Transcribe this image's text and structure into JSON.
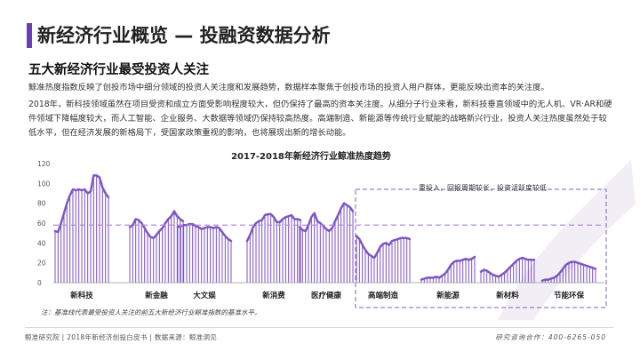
{
  "header": {
    "title": "新经济行业概览 — 投融资数据分析",
    "section_heading": "五大新经济行业最受投资人关注",
    "paragraph_1": "鲸准热度指数反映了创投市场中细分领域的投资人关注度和发展趋势，数据样本聚焦于创投市场的投资人用户群体，更能反映出资本的关注度。",
    "paragraph_2": "2018年，新科技领域虽然在项目受资和成立方面受影响程度较大，但仍保持了最高的资本关注度。从细分子行业来看，新科技垂直领域中的无人机、VR·AR和硬件领域下降幅度较大，而人工智能、企业服务、大数据等领域仍保持较高热度。高端制造、新能源等传统行业赋能的战略新兴行业，投资人关注热度虽然处于较低水平，但在经济发展的新格局下，受国家政策重视的影响，也将展现出新的增长动能。"
  },
  "footer": {
    "left": "鲸准研究院 | 2018年新经济创投白皮书 | 数据来源：鲸准洞见",
    "right": "研究咨询合作：400-6265-050"
  },
  "colors": {
    "accent": "#6a3fb5",
    "bars": "#7b4fc9",
    "line": "#7e57c2",
    "baseline": "#b58ad8",
    "box": "#7b62b8"
  },
  "chart_data": {
    "type": "bar",
    "title": "2017-2018年新经济行业鲸准热度趋势",
    "ylim": [
      0,
      120
    ],
    "y_ticks": [
      0,
      20,
      40,
      60,
      80,
      100,
      120
    ],
    "baseline": 58,
    "annotation": "重投入，回报周期较长，投资活跃度较低",
    "note": "注：基准线代表最受投资人关注的前五大新经济行业鲸准指数的基准水平。",
    "grid": false,
    "series": [
      {
        "name": "新科技",
        "values": [
          52,
          51,
          60,
          70,
          80,
          88,
          94,
          93,
          94,
          93,
          94,
          90,
          92,
          108,
          108,
          106,
          96,
          90,
          86
        ]
      },
      {
        "name": "新金融",
        "values": [
          56,
          58,
          64,
          63,
          60,
          55,
          50,
          46,
          45,
          48,
          52,
          55,
          60,
          64,
          67,
          72,
          67,
          64,
          62
        ]
      },
      {
        "name": "大文娱",
        "values": [
          56,
          57,
          58,
          58,
          59,
          59,
          57,
          56,
          54,
          55,
          56,
          56,
          55,
          56,
          55,
          51,
          47,
          44,
          42
        ]
      },
      {
        "name": "新消费",
        "values": [
          42,
          48,
          56,
          60,
          62,
          63,
          68,
          69,
          69,
          66,
          61,
          61,
          64,
          66,
          67,
          68,
          64,
          64,
          63
        ]
      },
      {
        "name": "医疗健康",
        "values": [
          56,
          53,
          52,
          58,
          66,
          70,
          62,
          60,
          57,
          54,
          52,
          55,
          62,
          68,
          75,
          80,
          78,
          76,
          72
        ]
      },
      {
        "name": "高端制造",
        "values": [
          47,
          44,
          38,
          33,
          29,
          27,
          25,
          30,
          36,
          39,
          40,
          38,
          42,
          43,
          44,
          45,
          45,
          45,
          44
        ]
      },
      {
        "name": "新能源",
        "values": [
          3,
          4,
          5,
          5,
          5,
          6,
          5,
          7,
          9,
          13,
          18,
          21,
          22,
          22,
          23,
          24,
          23,
          24,
          26
        ]
      },
      {
        "name": "新材料",
        "values": [
          11,
          13,
          12,
          10,
          8,
          7,
          6,
          8,
          10,
          13,
          16,
          19,
          22,
          24,
          25,
          24,
          23,
          23,
          23
        ]
      },
      {
        "name": "节能环保",
        "values": [
          2,
          3,
          3,
          4,
          5,
          7,
          10,
          14,
          18,
          20,
          21,
          21,
          20,
          19,
          18,
          17,
          16,
          15,
          14
        ]
      }
    ]
  }
}
